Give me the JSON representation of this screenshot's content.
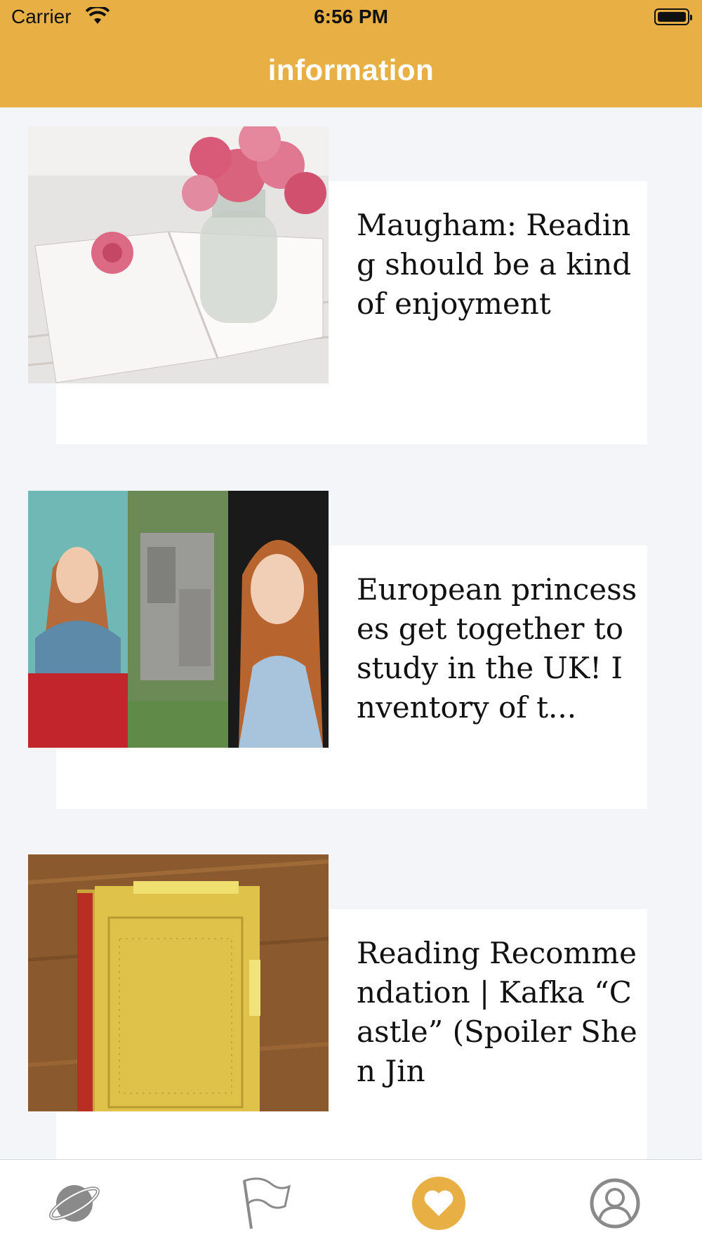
{
  "status_bar": {
    "carrier": "Carrier",
    "time": "6:56 PM"
  },
  "header": {
    "title": "information"
  },
  "articles": [
    {
      "title": "Maugham: Reading should be a kind of enjoyment"
    },
    {
      "title": "European princesses get together to study in the UK! Inventory of t..."
    },
    {
      "title": "Reading Recommendation | Kafka “Castle” (Spoiler Shen Jin"
    }
  ],
  "tabbar": {
    "tabs": [
      {
        "icon": "planet-icon",
        "active": false
      },
      {
        "icon": "flag-icon",
        "active": false
      },
      {
        "icon": "heart-icon",
        "active": true
      },
      {
        "icon": "user-icon",
        "active": false
      }
    ]
  },
  "colors": {
    "accent": "#e8b044",
    "background": "#f4f5f9",
    "card": "#ffffff",
    "inactive_icon": "#8a8a8a"
  }
}
